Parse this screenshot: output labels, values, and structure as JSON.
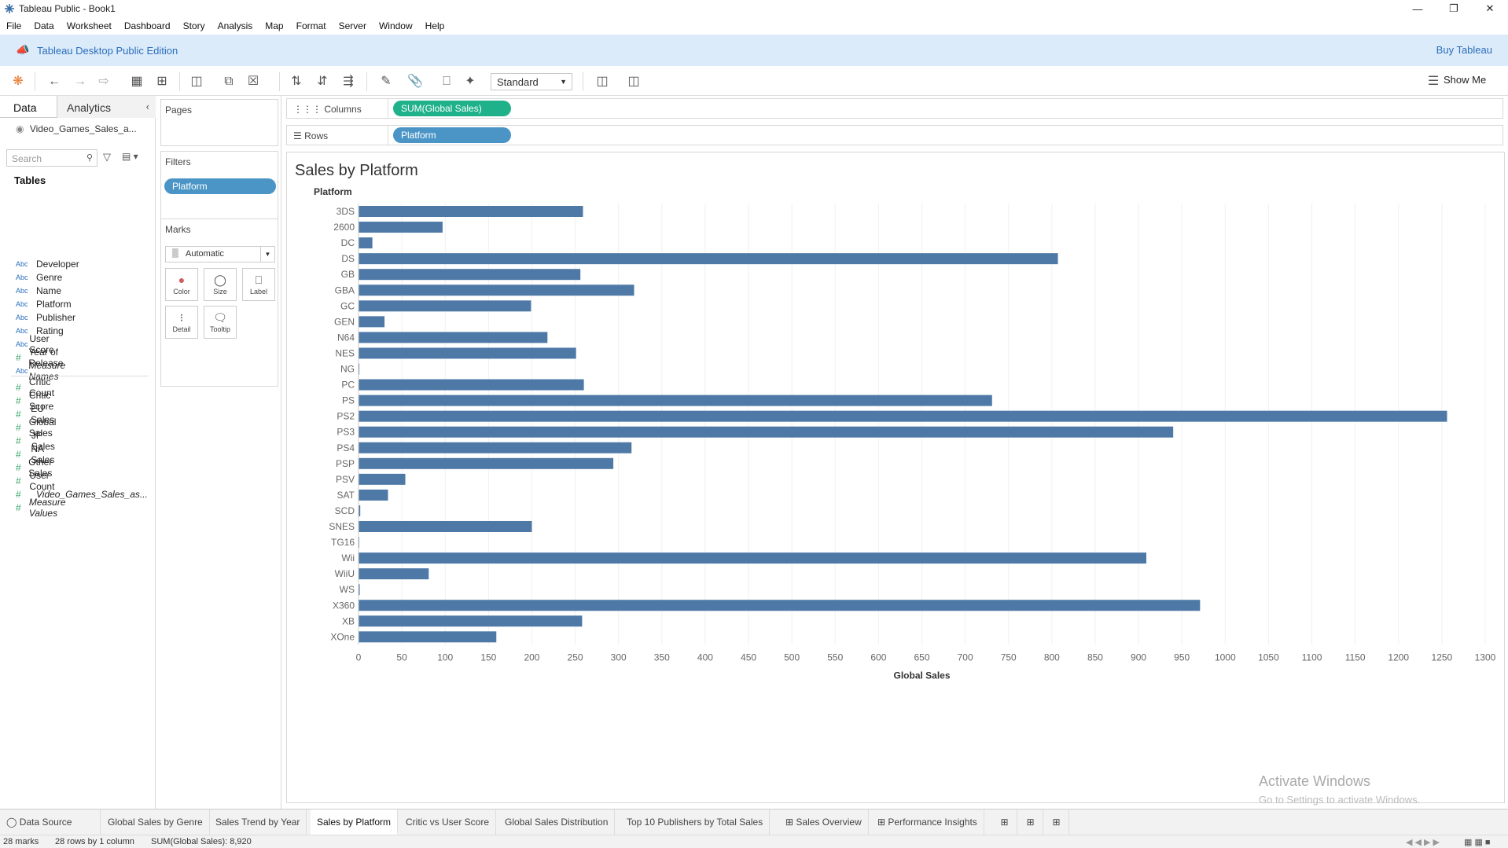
{
  "window": {
    "title": "Tableau Public - Book1"
  },
  "menu": [
    "File",
    "Data",
    "Worksheet",
    "Dashboard",
    "Story",
    "Analysis",
    "Map",
    "Format",
    "Server",
    "Window",
    "Help"
  ],
  "banner": {
    "edition": "Tableau Desktop Public Edition",
    "buy": "Buy Tableau"
  },
  "toolbar": {
    "fit": "Standard",
    "show_me": "Show Me"
  },
  "datapane": {
    "tab_data": "Data",
    "tab_analytics": "Analytics",
    "datasource": "Video_Games_Sales_a...",
    "search_placeholder": "Search",
    "tables_heading": "Tables",
    "fields": [
      {
        "type": "Abc",
        "name": "Developer",
        "italic": false
      },
      {
        "type": "Abc",
        "name": "Genre",
        "italic": false
      },
      {
        "type": "Abc",
        "name": "Name",
        "italic": false
      },
      {
        "type": "Abc",
        "name": "Platform",
        "italic": false
      },
      {
        "type": "Abc",
        "name": "Publisher",
        "italic": false
      },
      {
        "type": "Abc",
        "name": "Rating",
        "italic": false
      },
      {
        "type": "Abc",
        "name": "User Score",
        "italic": false
      },
      {
        "type": "#",
        "name": "Year of Release",
        "italic": false
      },
      {
        "type": "Abc",
        "name": "Measure Names",
        "italic": true
      },
      {
        "type": "#",
        "name": "Critic Count",
        "italic": false
      },
      {
        "type": "#",
        "name": "Critic Score",
        "italic": false
      },
      {
        "type": "#",
        "name": "EU Sales",
        "italic": false
      },
      {
        "type": "#",
        "name": "Global Sales",
        "italic": false
      },
      {
        "type": "#",
        "name": "JP Sales",
        "italic": false
      },
      {
        "type": "#",
        "name": "NA Sales",
        "italic": false
      },
      {
        "type": "#",
        "name": "Other Sales",
        "italic": false
      },
      {
        "type": "#",
        "name": "User Count",
        "italic": false
      },
      {
        "type": "#",
        "name": "Video_Games_Sales_as...",
        "italic": true
      },
      {
        "type": "#",
        "name": "Measure Values",
        "italic": true
      }
    ]
  },
  "cards": {
    "pages": "Pages",
    "filters": "Filters",
    "filter_pill": "Platform",
    "marks": "Marks",
    "mark_type": "Automatic",
    "mark_buttons": [
      "Color",
      "Size",
      "Label",
      "Detail",
      "Tooltip"
    ]
  },
  "shelves": {
    "columns_label": "Columns",
    "columns_pill": "SUM(Global Sales)",
    "rows_label": "Rows",
    "rows_pill": "Platform"
  },
  "chart_data": {
    "type": "bar",
    "orientation": "horizontal",
    "title": "Sales by Platform",
    "ylabel": "Platform",
    "xlabel": "Global Sales",
    "xlim": [
      0,
      1300
    ],
    "xticks": [
      0,
      50,
      100,
      150,
      200,
      250,
      300,
      350,
      400,
      450,
      500,
      550,
      600,
      650,
      700,
      750,
      800,
      850,
      900,
      950,
      1000,
      1050,
      1100,
      1150,
      1200,
      1250,
      1300
    ],
    "categories": [
      "3DS",
      "2600",
      "DC",
      "DS",
      "GB",
      "GBA",
      "GC",
      "GEN",
      "N64",
      "NES",
      "NG",
      "PC",
      "PS",
      "PS2",
      "PS3",
      "PS4",
      "PSP",
      "PSV",
      "SAT",
      "SCD",
      "SNES",
      "TG16",
      "Wii",
      "WiiU",
      "WS",
      "X360",
      "XB",
      "XOne"
    ],
    "values": [
      259,
      97,
      16,
      807,
      256,
      318,
      199,
      30,
      218,
      251,
      1,
      260,
      731,
      1256,
      940,
      315,
      294,
      54,
      34,
      2,
      200,
      0.2,
      909,
      81,
      1.4,
      971,
      258,
      159
    ],
    "color": "#4e79a7",
    "grid": "vertical"
  },
  "sheet_tabs": [
    "Data Source",
    "Global Sales by Genre",
    "Sales Trend by Year",
    "Sales by Platform",
    "Critic vs User Score",
    "Global Sales Distribution",
    "Top 10 Publishers by Total Sales",
    "Sales Overview",
    "Performance Insights"
  ],
  "active_tab": "Sales by Platform",
  "status": {
    "marks": "28 marks",
    "dims": "28 rows by 1 column",
    "sum": "SUM(Global Sales): 8,920"
  },
  "watermark": {
    "line1": "Activate Windows",
    "line2": "Go to Settings to activate Windows."
  }
}
